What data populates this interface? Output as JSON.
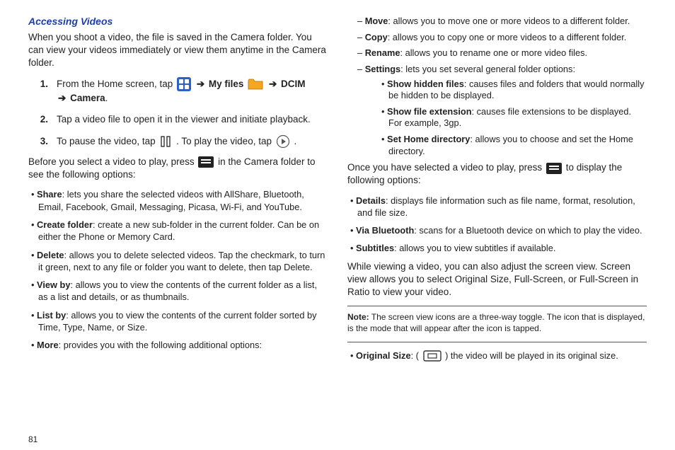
{
  "pageNumber": "81",
  "heading": "Accessing Videos",
  "intro": "When you shoot a video, the file is saved in the Camera folder. You can view your videos immediately or view them anytime in the Camera folder.",
  "steps": {
    "s1_a": "From the Home screen, tap ",
    "s1_b": " My files ",
    "s1_c": " DCIM ",
    "s1_d": " Camera",
    "s2": "Tap a video file to open it in the viewer and initiate playback.",
    "s3_a": "To pause the video, tap ",
    "s3_b": ". To play the video, tap ",
    "s3_c": "."
  },
  "arrow": "➔",
  "preOptions_a": "Before you select a video to play, press ",
  "preOptions_b": " in the Camera folder to see the following options:",
  "leftBullets": {
    "share_t": "Share",
    "share_d": ": lets you share the selected videos with AllShare, Bluetooth, Email, Facebook, Gmail, Messaging, Picasa, Wi-Fi, and YouTube.",
    "create_t": "Create folder",
    "create_d": ": create a new sub-folder in the current folder. Can be on either the Phone or Memory Card.",
    "delete_t": "Delete",
    "delete_d": ": allows you to delete selected videos. Tap the checkmark, to turn it green, next to any file or folder you want to delete, then tap Delete.",
    "view_t": "View by",
    "view_d": ": allows you to view the contents of the current folder as a list, as a list and details, or as thumbnails.",
    "list_t": "List by",
    "list_d": ": allows you to view the contents of the current folder sorted by Time, Type, Name, or Size.",
    "more_t": "More",
    "more_d": ": provides you with the following additional options:"
  },
  "moreSub": {
    "move_t": "Move",
    "move_d": ": allows you to move one or more videos to a different folder.",
    "copy_t": "Copy",
    "copy_d": ": allows you to copy one or more videos to a different folder.",
    "rename_t": "Rename",
    "rename_d": ": allows you to rename one or more video files.",
    "settings_t": "Settings",
    "settings_d": ": lets you set several general folder options:"
  },
  "settingsSub": {
    "hidden_t": "Show hidden files",
    "hidden_d": ": causes files and folders that would normally be hidden to be displayed.",
    "ext_t": "Show file extension",
    "ext_d": ": causes file extensions to be displayed. For example, 3gp.",
    "home_t": "Set Home directory",
    "home_d": ": allows you to choose and set the Home directory."
  },
  "afterSelect_a": "Once you have selected a video to play, press ",
  "afterSelect_b": " to display the following options:",
  "rightBullets": {
    "details_t": "Details",
    "details_d": ": displays file information such as file name, format, resolution, and file size.",
    "bt_t": "Via Bluetooth",
    "bt_d": ": scans for a Bluetooth device on which to play the video.",
    "sub_t": "Subtitles",
    "sub_d": ": allows you to view subtitles if available."
  },
  "screenView": "While viewing a video, you can also adjust the screen view. Screen view allows you to select Original Size, Full-Screen, or Full-Screen in Ratio to view your video.",
  "note_t": "Note:",
  "note_d": " The screen view icons are a three-way toggle. The icon that is displayed, is the mode that will appear after the icon is tapped.",
  "orig_t": "Original Size",
  "orig_a": ": (",
  "orig_b": ") the video will be played in its original size."
}
